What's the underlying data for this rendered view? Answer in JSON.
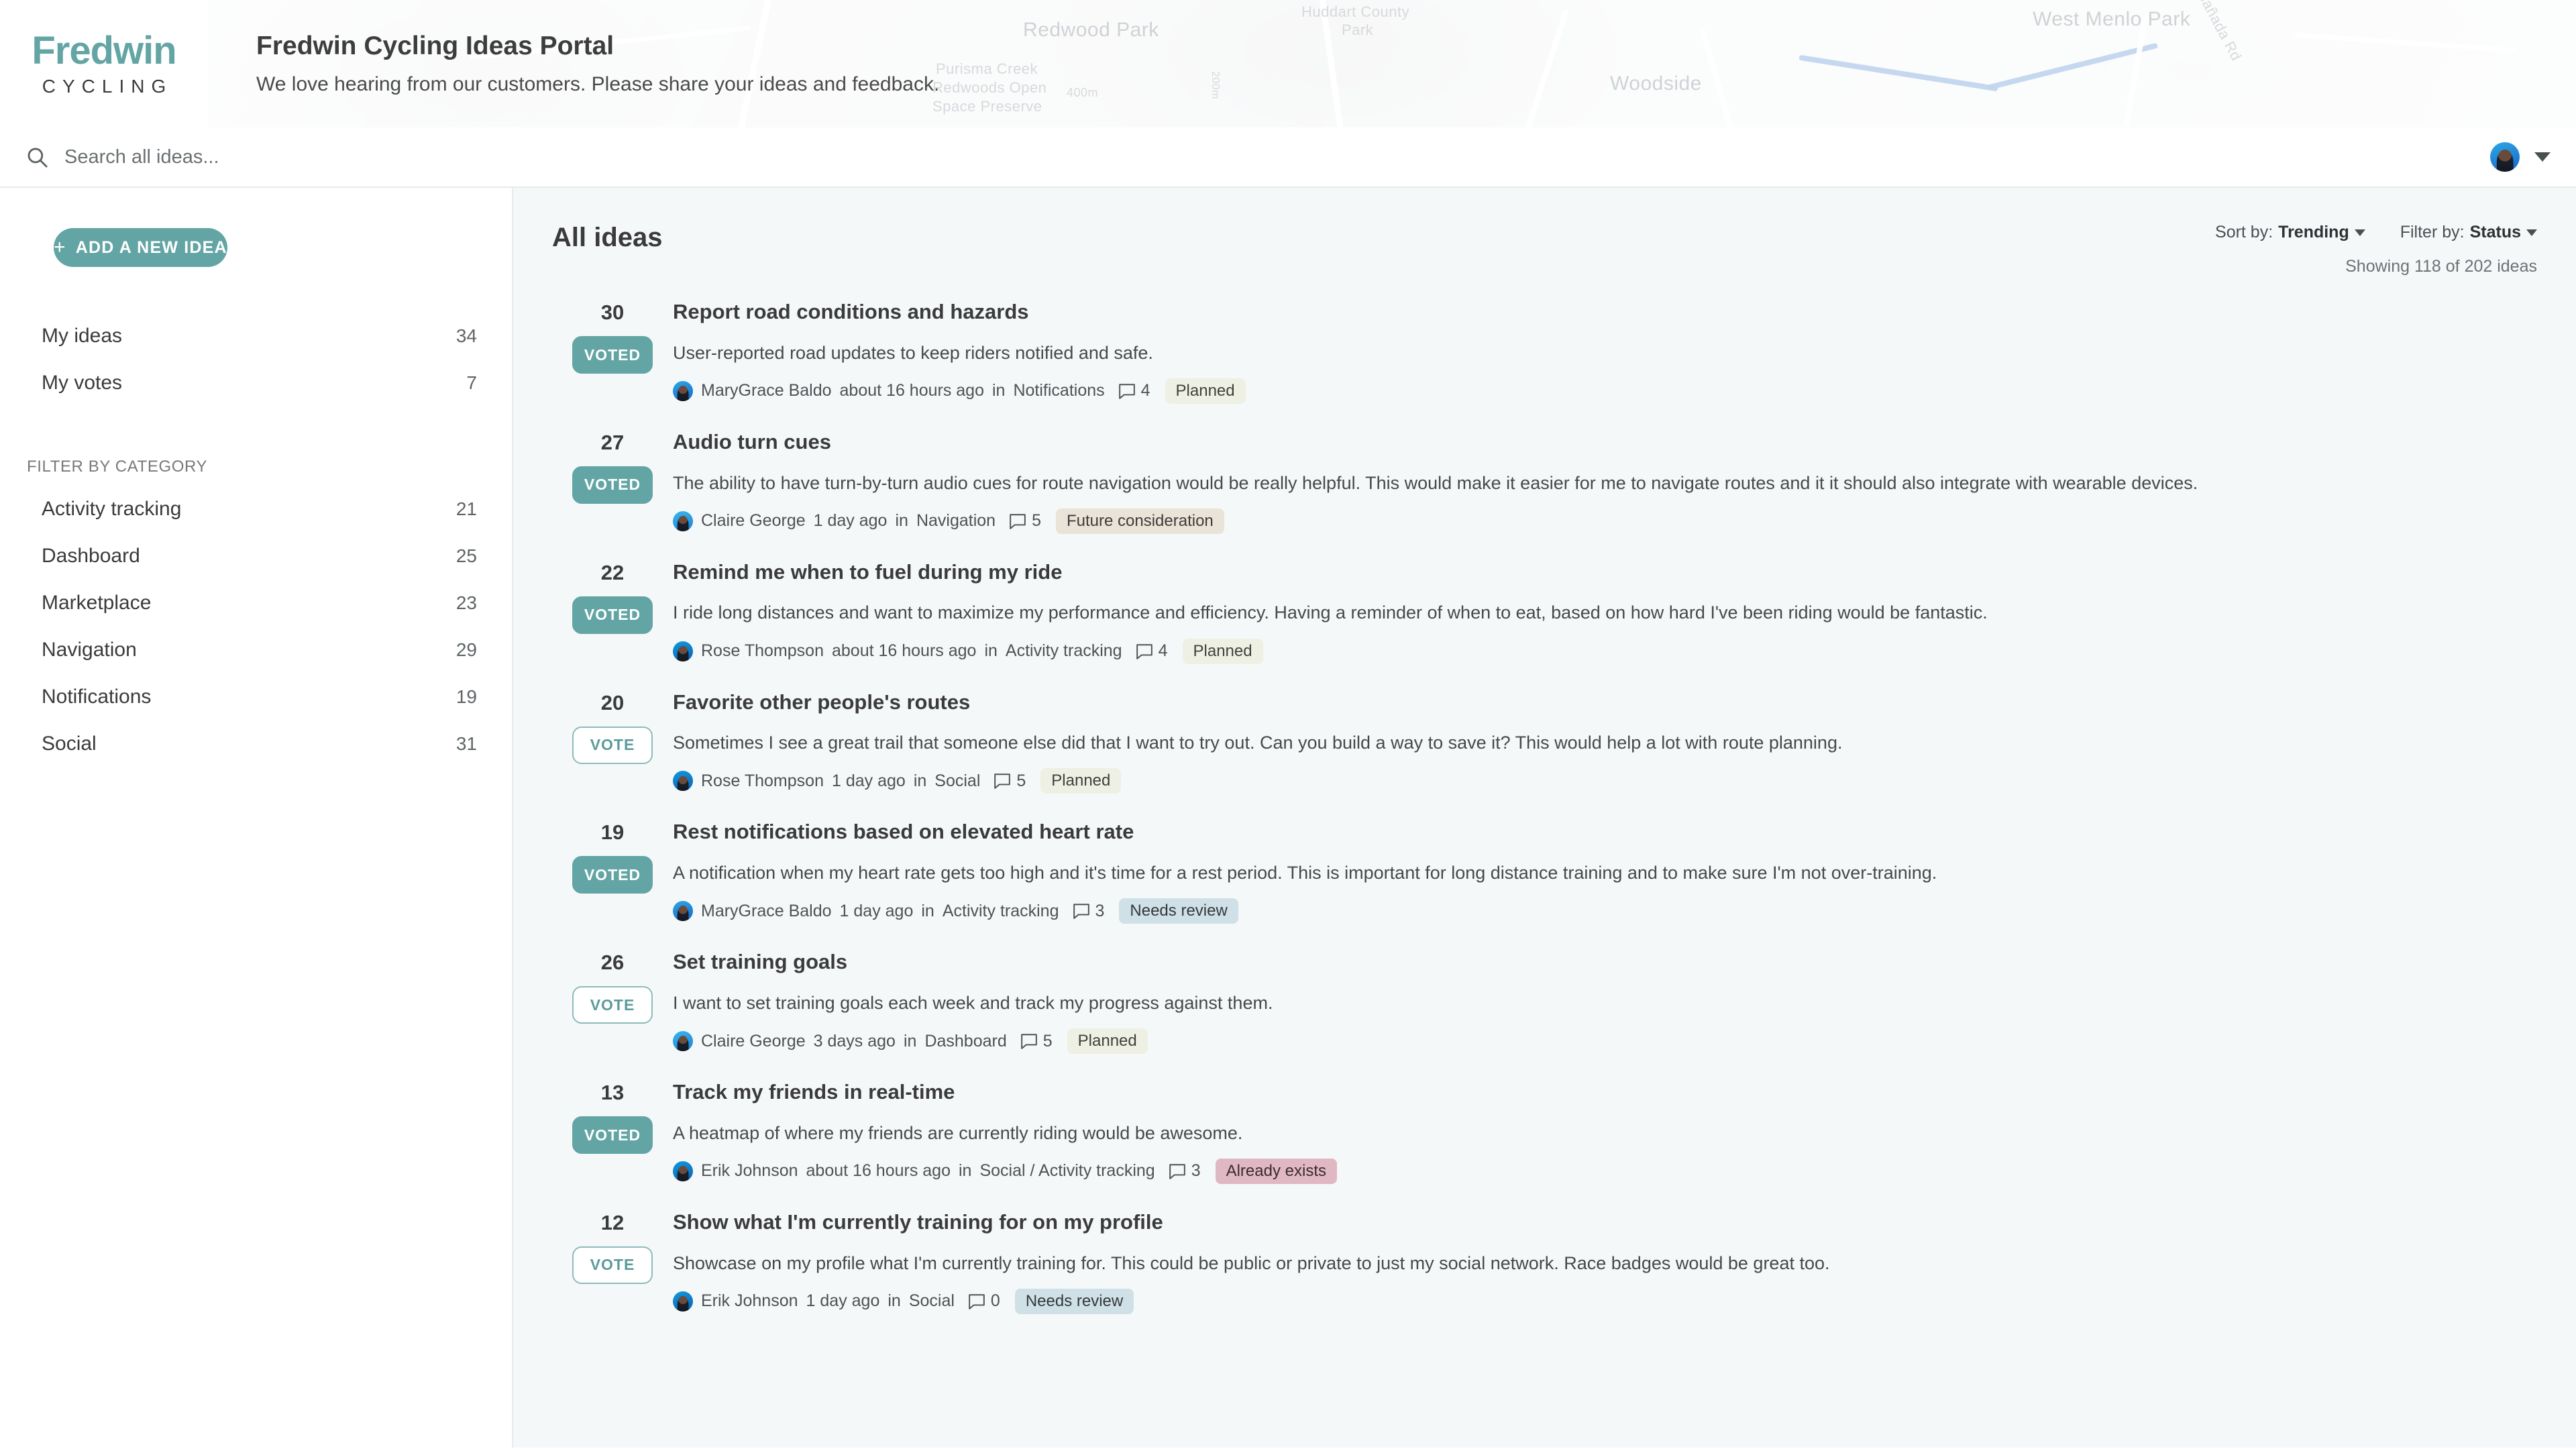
{
  "header": {
    "logo_word": "Fredwin",
    "logo_sub": "CYCLING",
    "title": "Fredwin Cycling Ideas Portal",
    "subtitle": "We love hearing from our customers. Please share your ideas and feedback.",
    "map_labels": [
      "Redwood Park",
      "Huddart County",
      "Park",
      "Woodside",
      "West Menlo Park",
      "Purisma Creek",
      "Redwoods Open",
      "Space Preserve",
      "Cañada Rd",
      "400m",
      "200m"
    ]
  },
  "search": {
    "placeholder": "Search all ideas...",
    "value": "",
    "icon": "search-icon"
  },
  "user_menu": {
    "avatar": "user-avatar",
    "caret": "chevron-down-icon"
  },
  "sidebar": {
    "add_idea_label": "ADD A NEW IDEA",
    "add_idea_icon": "plus-icon",
    "nav": [
      {
        "label": "My ideas",
        "count": "34"
      },
      {
        "label": "My votes",
        "count": "7"
      }
    ],
    "category_section_title": "FILTER BY CATEGORY",
    "categories": [
      {
        "label": "Activity tracking",
        "count": "21"
      },
      {
        "label": "Dashboard",
        "count": "25"
      },
      {
        "label": "Marketplace",
        "count": "23"
      },
      {
        "label": "Navigation",
        "count": "29"
      },
      {
        "label": "Notifications",
        "count": "19"
      },
      {
        "label": "Social",
        "count": "31"
      }
    ]
  },
  "main": {
    "title": "All ideas",
    "sort_prefix": "Sort by:",
    "sort_value": "Trending",
    "filter_prefix": "Filter by:",
    "filter_value": "Status",
    "showing": "Showing 118 of 202 ideas"
  },
  "colors": {
    "brand_teal": "#63a5a4",
    "page_bg": "#f5f8f9",
    "badge_planned": "#eef0e3",
    "badge_future": "#e9e3d8",
    "badge_needs_review": "#cfe0e6",
    "badge_already_exists": "#e0b8c3"
  },
  "ideas": [
    {
      "votes": "30",
      "vote_label": "VOTED",
      "voted": true,
      "title": "Report road conditions and hazards",
      "desc": "User-reported road updates to keep riders notified and safe.",
      "author": "MaryGrace Baldo",
      "time": "about 16 hours ago",
      "in_word": "in",
      "category": "Notifications",
      "comments": "4",
      "status": "Planned",
      "status_class": "badge-planned",
      "avatar_class": ""
    },
    {
      "votes": "27",
      "vote_label": "VOTED",
      "voted": true,
      "title": "Audio turn cues",
      "desc": "The ability to have turn-by-turn audio cues for route navigation would be really helpful. This would make it easier for me to navigate routes and it it should also integrate with wearable devices.",
      "author": "Claire George",
      "time": "1 day ago",
      "in_word": "in",
      "category": "Navigation",
      "comments": "5",
      "status": "Future consideration",
      "status_class": "badge-future",
      "avatar_class": "w2"
    },
    {
      "votes": "22",
      "vote_label": "VOTED",
      "voted": true,
      "title": "Remind me when to fuel during my ride",
      "desc": "I ride long distances and want to maximize my performance and efficiency. Having a reminder of when to eat, based on how hard I've been riding would be fantastic.",
      "author": "Rose Thompson",
      "time": "about 16 hours ago",
      "in_word": "in",
      "category": "Activity tracking",
      "comments": "4",
      "status": "Planned",
      "status_class": "badge-planned",
      "avatar_class": "w3"
    },
    {
      "votes": "20",
      "vote_label": "VOTE",
      "voted": false,
      "title": "Favorite other people's routes",
      "desc": "Sometimes I see a great trail that someone else did that I want to try out. Can you build a way to save it? This would help a lot with route planning.",
      "author": "Rose Thompson",
      "time": "1 day ago",
      "in_word": "in",
      "category": "Social",
      "comments": "5",
      "status": "Planned",
      "status_class": "badge-planned",
      "avatar_class": "w3"
    },
    {
      "votes": "19",
      "vote_label": "VOTED",
      "voted": true,
      "title": "Rest notifications based on elevated heart rate",
      "desc": "A notification when my heart rate gets too high and it's time for a rest period. This is important for long distance training and to make sure I'm not over-training.",
      "author": "MaryGrace Baldo",
      "time": "1 day ago",
      "in_word": "in",
      "category": "Activity tracking",
      "comments": "3",
      "status": "Needs review",
      "status_class": "badge-needs",
      "avatar_class": ""
    },
    {
      "votes": "26",
      "vote_label": "VOTE",
      "voted": false,
      "title": "Set training goals",
      "desc": "I want to set training goals each week and track my progress against them.",
      "author": "Claire George",
      "time": "3 days ago",
      "in_word": "in",
      "category": "Dashboard",
      "comments": "5",
      "status": "Planned",
      "status_class": "badge-planned",
      "avatar_class": "w2"
    },
    {
      "votes": "13",
      "vote_label": "VOTED",
      "voted": true,
      "title": "Track my friends in real-time",
      "desc": "A heatmap of where my friends are currently riding would be awesome.",
      "author": "Erik Johnson",
      "time": "about 16 hours ago",
      "in_word": "in",
      "category": "Social / Activity tracking",
      "comments": "3",
      "status": "Already exists",
      "status_class": "badge-exists",
      "avatar_class": "w3"
    },
    {
      "votes": "12",
      "vote_label": "VOTE",
      "voted": false,
      "title": "Show what I'm currently training for on my profile",
      "desc": "Showcase on my profile what I'm currently training for. This could be public or private to just my social network. Race badges would be great too.",
      "author": "Erik Johnson",
      "time": "1 day ago",
      "in_word": "in",
      "category": "Social",
      "comments": "0",
      "status": "Needs review",
      "status_class": "badge-needs",
      "avatar_class": "w3"
    }
  ]
}
